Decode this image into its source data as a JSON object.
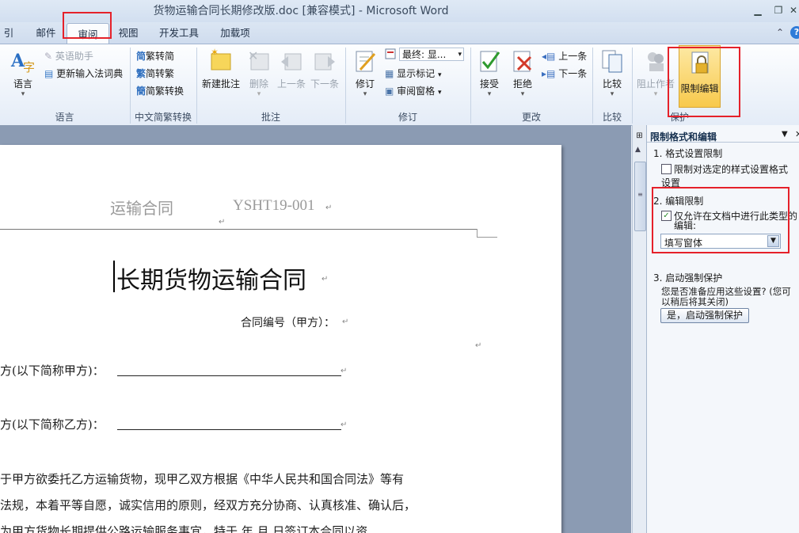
{
  "window": {
    "title": "货物运输合同长期修改版.doc [兼容模式] - Microsoft Word"
  },
  "tabs": [
    {
      "label": "引用"
    },
    {
      "label": "邮件"
    },
    {
      "label": "审阅"
    },
    {
      "label": "视图"
    },
    {
      "label": "开发工具"
    },
    {
      "label": "加载项"
    }
  ],
  "ribbon": {
    "language": {
      "label": "语言",
      "english_assistant": "英语助手",
      "update_ime": "更新输入法词典",
      "language_btn": "语言"
    },
    "chinese_convert": {
      "label": "中文简繁转换",
      "trad_to_simp": "繁转简",
      "simp_to_trad": "简转繁",
      "convert": "简繁转换"
    },
    "comments": {
      "label": "批注",
      "new_comment": "新建批注",
      "delete": "删除",
      "previous": "上一条",
      "next": "下一条"
    },
    "tracking": {
      "label": "修订",
      "track": "修订",
      "final_display": "最终: 显...",
      "show_markup": "显示标记",
      "review_pane": "审阅窗格"
    },
    "changes": {
      "label": "更改",
      "accept": "接受",
      "reject": "拒绝",
      "previous": "上一条",
      "next": "下一条"
    },
    "compare": {
      "label": "比较",
      "compare_btn": "比较"
    },
    "protect": {
      "label": "保护",
      "block_authors": "阻止作者",
      "restrict_editing": "限制编辑"
    }
  },
  "document": {
    "header_left": "运输合同",
    "header_right": "YSHT19-001",
    "title": "长期货物运输合同",
    "contract_no": "合同编号（甲方）：",
    "party_a": "方(以下简称甲方)：",
    "party_b": "方(以下简称乙方)：",
    "para_line1": "于甲方欲委托乙方运输货物，现甲乙双方根据《中华人民共和国合同法》等有",
    "para_line2": "法规，本着平等自愿，诚实信用的原则，经双方充分协商、认真核准、确认后，",
    "para_line3": "为甲方货物长期提供公路运输服务事宜，特于    年    月    日签订本合同以资"
  },
  "pane": {
    "title": "限制格式和编辑",
    "section1_title": "1.  格式设置限制",
    "section1_option_line1": "限制对选定的样式设置格式",
    "section1_option_line2": "设置",
    "section2_title": "2.  编辑限制",
    "section2_option_line1": "仅允许在文档中进行此类型的",
    "section2_option_line2": "编辑:",
    "edit_type_value": "填写窗体",
    "section3_title": "3.  启动强制保护",
    "section3_desc_line1": "您是否准备应用这些设置? (您可",
    "section3_desc_line2": "以稍后将其关闭)",
    "start_button": "是，启动强制保护"
  }
}
